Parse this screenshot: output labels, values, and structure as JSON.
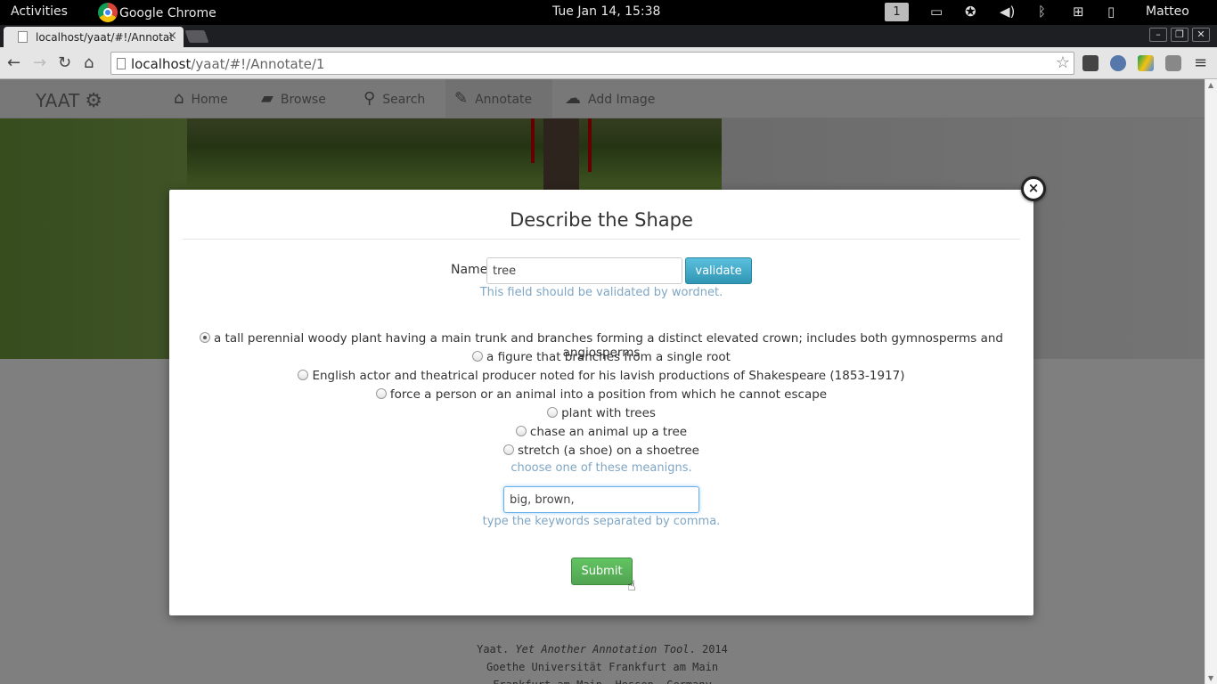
{
  "system_bar": {
    "activities": "Activities",
    "app_name": "Google Chrome",
    "clock": "Tue Jan 14, 15:38",
    "workspace": "1",
    "user": "Matteo"
  },
  "browser": {
    "tab_title": "localhost/yaat/#!/Annotat",
    "tab_close": "×",
    "url_host": "localhost",
    "url_path": "/yaat/#!/Annotate/1"
  },
  "app": {
    "brand": "YAAT",
    "nav": [
      {
        "label": "Home",
        "icon": "home-icon"
      },
      {
        "label": "Browse",
        "icon": "folder-icon"
      },
      {
        "label": "Search",
        "icon": "search-icon"
      },
      {
        "label": "Annotate",
        "icon": "pencil-icon",
        "active": true
      },
      {
        "label": "Add Image",
        "icon": "cloud-upload-icon"
      }
    ],
    "footer": {
      "line1_prefix": "Yaat. ",
      "line1_italic": "Yet Another Annotation Tool",
      "line1_suffix": ". 2014",
      "line2": "Goethe Universität Frankfurt am Main",
      "line3": "Frankfurt am Main, Hessen, Germany"
    }
  },
  "modal": {
    "title": "Describe the Shape",
    "close": "×",
    "name_label": "Name",
    "name_value": "tree",
    "validate_label": "validate",
    "name_help": "This field should be validated by wordnet.",
    "meanings": [
      {
        "label": "a tall perennial woody plant having a main trunk and branches forming a distinct elevated crown; includes both gymnosperms and angiosperms",
        "checked": true
      },
      {
        "label": "a figure that branches from a single root",
        "checked": false
      },
      {
        "label": "English actor and theatrical producer noted for his lavish productions of Shakespeare (1853-1917)",
        "checked": false
      },
      {
        "label": "force a person or an animal into a position from which he cannot escape",
        "checked": false
      },
      {
        "label": "plant with trees",
        "checked": false
      },
      {
        "label": "chase an animal up a tree",
        "checked": false
      },
      {
        "label": "stretch (a shoe) on a shoetree",
        "checked": false
      }
    ],
    "meanings_help": "choose one of these meanigns.",
    "keywords_value": "big, brown, ",
    "keywords_help": "type the keywords separated by comma.",
    "submit_label": "Submit"
  },
  "colors": {
    "validate_button": "#2f96b4",
    "submit_button": "#51a351",
    "help_text": "#7fa6c4"
  }
}
